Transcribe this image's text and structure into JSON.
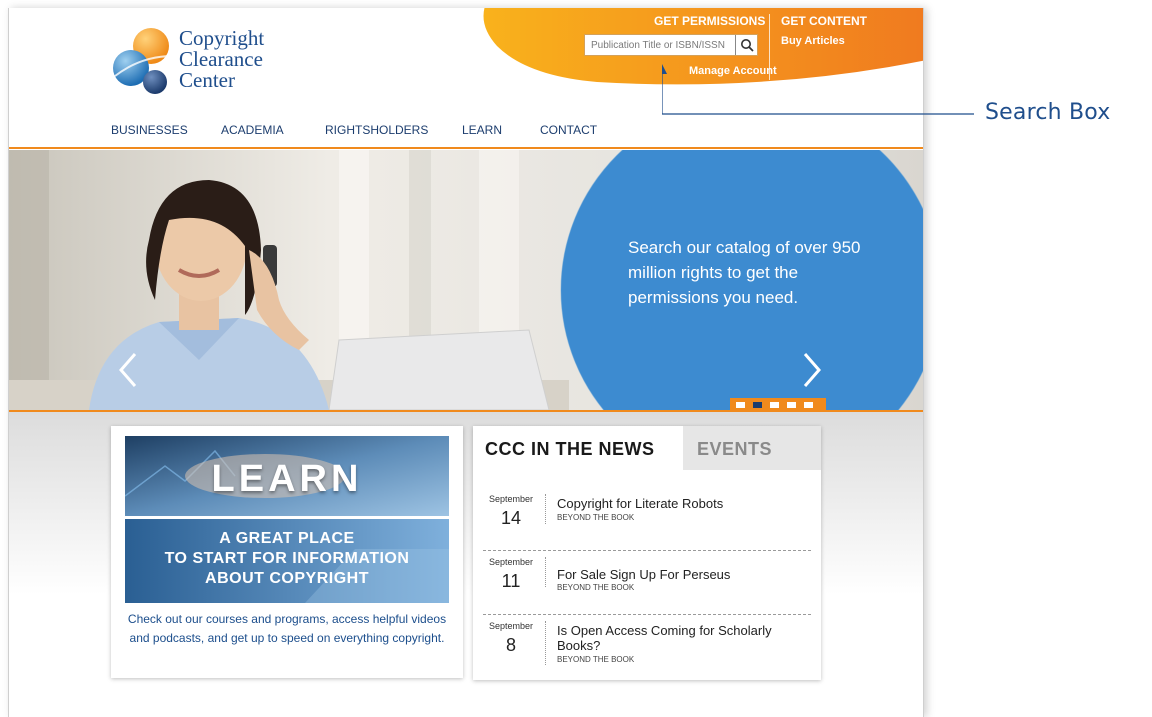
{
  "logo": {
    "line1": "Copyright",
    "line2": "Clearance",
    "line3": "Center"
  },
  "header": {
    "get_permissions": "GET PERMISSIONS",
    "get_content": "GET CONTENT",
    "buy_articles": "Buy Articles",
    "manage_account": "Manage Account",
    "search_placeholder": "Publication Title or ISBN/ISSN",
    "colors": {
      "orange_start": "#f7a81b",
      "orange_end": "#f07c1e",
      "navy": "#1c3d6e"
    }
  },
  "nav": {
    "items": [
      "BUSINESSES",
      "ACADEMIA",
      "RIGHTSHOLDERS",
      "LEARN",
      "CONTACT"
    ]
  },
  "hero": {
    "caption": "Search our catalog of over 950 million rights to get the permissions you need.",
    "slide_count": 5,
    "active_slide": 2,
    "circle_color": "#3d8bd0"
  },
  "learn": {
    "title": "LEARN",
    "sub1": "A GREAT PLACE",
    "sub2": "TO START FOR INFORMATION",
    "sub3": "ABOUT COPYRIGHT",
    "description": "Check out our courses and programs, access helpful videos and podcasts, and get up to speed on everything copyright."
  },
  "news": {
    "tab_news": "CCC IN THE NEWS",
    "tab_events": "EVENTS",
    "items": [
      {
        "month": "September",
        "day": "14",
        "title": "Copyright for Literate Robots",
        "source": "BEYOND THE BOOK"
      },
      {
        "month": "September",
        "day": "11",
        "title": "For Sale Sign Up For Perseus",
        "source": "BEYOND THE BOOK"
      },
      {
        "month": "September",
        "day": "8",
        "title": "Is Open Access Coming for Scholarly Books?",
        "source": "BEYOND THE BOOK"
      }
    ]
  },
  "annotation": {
    "label": "Search Box"
  }
}
